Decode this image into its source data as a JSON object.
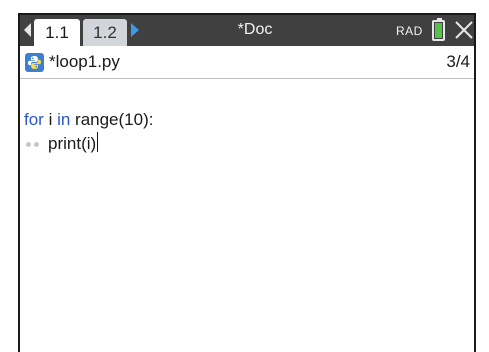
{
  "topbar": {
    "tabs": [
      {
        "label": "1.1",
        "active": true
      },
      {
        "label": "1.2",
        "active": false
      }
    ],
    "document_title": "*Doc",
    "angle_mode": "RAD"
  },
  "file": {
    "name": "*loop1.py",
    "page_count": "3/4"
  },
  "editor": {
    "lines": [
      {
        "keyword_1": "for",
        "var": " i ",
        "keyword_2": "in",
        "rest": " range(10):"
      },
      {
        "code": "print(i)"
      }
    ]
  },
  "colors": {
    "topbar": "#404040",
    "keyword": "#2b57c9",
    "battery": "#57c24a",
    "nav_arrow": "#3f97e8"
  }
}
